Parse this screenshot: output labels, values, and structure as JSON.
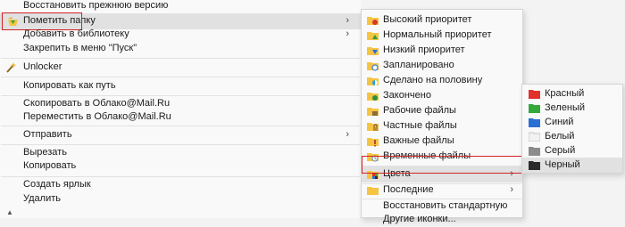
{
  "main_menu": {
    "items": [
      {
        "label": "Восстановить прежнюю версию"
      },
      {
        "label": "Пометить папку"
      },
      {
        "label": "Добавить в библиотеку"
      },
      {
        "label": "Закрепить в меню \"Пуск\""
      },
      {
        "label": "Unlocker"
      },
      {
        "label": "Копировать как путь"
      },
      {
        "label": "Скопировать в Облако@Mail.Ru"
      },
      {
        "label": "Переместить в Облако@Mail.Ru"
      },
      {
        "label": "Отправить"
      },
      {
        "label": "Вырезать"
      },
      {
        "label": "Копировать"
      },
      {
        "label": "Создать ярлык"
      },
      {
        "label": "Удалить"
      }
    ]
  },
  "submenu": {
    "items": [
      {
        "label": "Высокий приоритет",
        "badge_color": "#d33a2c"
      },
      {
        "label": "Нормальный приоритет",
        "badge_color": "#2e9c3a"
      },
      {
        "label": "Низкий приоритет",
        "badge_color": "#2f6fd0"
      },
      {
        "label": "Запланировано",
        "badge_color": "#3b7dd8"
      },
      {
        "label": "Сделано на половину",
        "badge_color": "#2aa3d6"
      },
      {
        "label": "Закончено",
        "badge_color": "#2c8f3c"
      },
      {
        "label": "Рабочие файлы",
        "badge_color": "#8a6b3a"
      },
      {
        "label": "Частные файлы",
        "badge_color": "#b8893a"
      },
      {
        "label": "Важные файлы",
        "badge_color": "#c24a2a"
      },
      {
        "label": "Временные файлы",
        "badge_color": "#6a8fb8"
      },
      {
        "label": "Цвета"
      },
      {
        "label": "Последние"
      },
      {
        "label": "Восстановить стандартную"
      },
      {
        "label": "Другие иконки..."
      }
    ]
  },
  "colors_menu": {
    "items": [
      {
        "label": "Красный",
        "color": "#e0312b"
      },
      {
        "label": "Зеленый",
        "color": "#33a83d"
      },
      {
        "label": "Синий",
        "color": "#2a6fd6"
      },
      {
        "label": "Белый",
        "color": "#f2f2f2"
      },
      {
        "label": "Серый",
        "color": "#8c8c8c"
      },
      {
        "label": "Черный",
        "color": "#2b2b2b"
      }
    ]
  },
  "colors": {
    "highlight_border": "#d02424",
    "folder_yellow": "#f6c443"
  }
}
